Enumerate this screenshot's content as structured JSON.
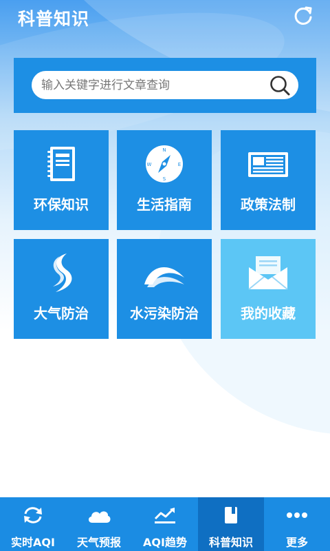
{
  "header": {
    "title": "科普知识",
    "refresh_icon": "refresh-icon"
  },
  "search": {
    "placeholder": "输入关键字进行文章查询",
    "icon": "search-icon"
  },
  "tiles": [
    {
      "label": "环保知识",
      "icon": "notebook-icon",
      "color": "#1d8fe4"
    },
    {
      "label": "生活指南",
      "icon": "compass-icon",
      "color": "#1d8fe4"
    },
    {
      "label": "政策法制",
      "icon": "newspaper-icon",
      "color": "#1d8fe4"
    },
    {
      "label": "大气防治",
      "icon": "air-swirl-icon",
      "color": "#1d8fe4"
    },
    {
      "label": "水污染防治",
      "icon": "water-wave-icon",
      "color": "#1d8fe4"
    },
    {
      "label": "我的收藏",
      "icon": "envelope-icon",
      "color": "#5cc6f5"
    }
  ],
  "tabbar": {
    "active_index": 3,
    "items": [
      {
        "label": "实时AQI",
        "icon": "sync-arrows-icon"
      },
      {
        "label": "天气预报",
        "icon": "cloud-icon"
      },
      {
        "label": "AQI趋势",
        "icon": "trend-chart-icon"
      },
      {
        "label": "科普知识",
        "icon": "book-icon"
      },
      {
        "label": "更多",
        "icon": "more-dots-icon"
      }
    ]
  },
  "colors": {
    "primary": "#1d8fe4",
    "tile_highlight": "#5cc6f5",
    "tab_active": "#0f6fc2"
  }
}
